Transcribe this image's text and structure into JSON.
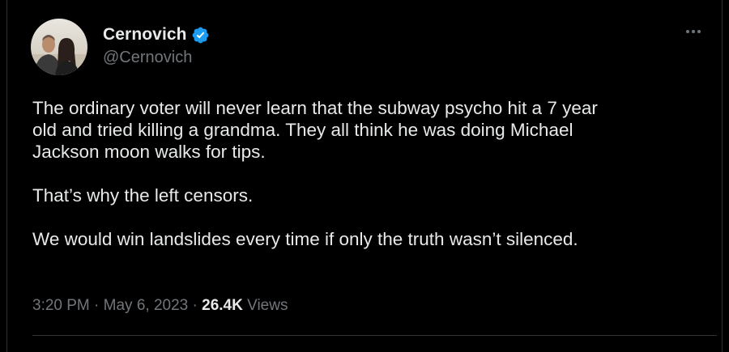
{
  "author": {
    "display_name": "Cernovich",
    "handle": "@Cernovich",
    "verified": true,
    "verified_color": "#1d9bf0"
  },
  "more_menu": {
    "icon": "more-horizontal-icon"
  },
  "tweet": {
    "paragraphs": [
      "The ordinary voter will never learn that the subway psycho hit a 7 year\nold and tried killing a grandma. They all think he was doing Michael\nJackson moon walks for tips.",
      "That’s why the left censors.",
      "We would win landslides every time if only the truth wasn’t silenced."
    ]
  },
  "meta": {
    "time": "3:20 PM",
    "separator": "·",
    "date": "May 6, 2023",
    "views_count": "26.4K",
    "views_label": "Views"
  },
  "colors": {
    "background": "#000000",
    "primary_text": "#e7e9ea",
    "secondary_text": "#71767b",
    "border": "#2f3336"
  }
}
